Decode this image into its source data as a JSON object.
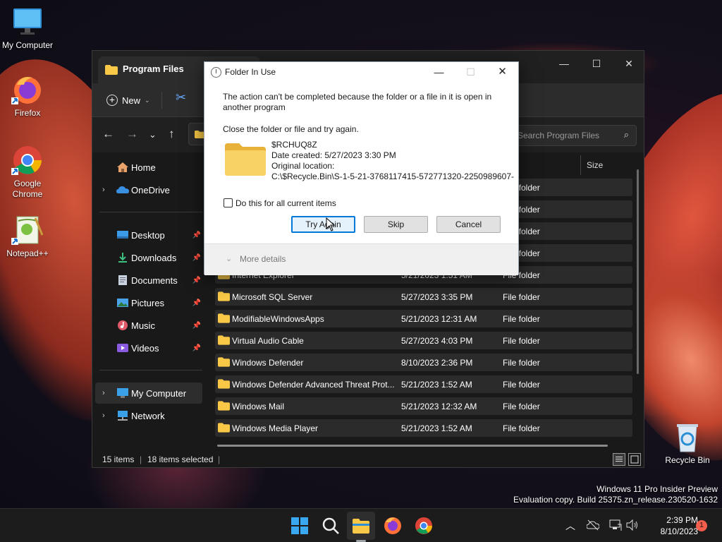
{
  "desktop": {
    "icons": [
      {
        "label": "My Computer",
        "icon": "monitor-icon"
      },
      {
        "label": "Firefox",
        "icon": "firefox-icon"
      },
      {
        "label": "Google Chrome",
        "icon": "chrome-icon"
      },
      {
        "label": "Notepad++",
        "icon": "notepadpp-icon"
      },
      {
        "label": "Recycle Bin",
        "icon": "recycle-bin-icon"
      }
    ],
    "watermark_line1": "Windows 11 Pro Insider Preview",
    "watermark_line2": "Evaluation copy. Build 25375.zn_release.230520-1632"
  },
  "explorer": {
    "tab_title": "Program Files",
    "new_label": "New",
    "search_placeholder": "Search Program Files",
    "size_header": "Size",
    "sidebar": [
      {
        "label": "Home"
      },
      {
        "label": "OneDrive"
      },
      {
        "label": "Desktop"
      },
      {
        "label": "Downloads"
      },
      {
        "label": "Documents"
      },
      {
        "label": "Pictures"
      },
      {
        "label": "Music"
      },
      {
        "label": "Videos"
      },
      {
        "label": "My Computer"
      },
      {
        "label": "Network"
      }
    ],
    "rows": [
      {
        "name": "",
        "date": "",
        "type": "File folder"
      },
      {
        "name": "",
        "date": "",
        "type": "File folder"
      },
      {
        "name": "",
        "date": "",
        "type": "File folder"
      },
      {
        "name": "",
        "date": "",
        "type": "File folder"
      },
      {
        "name": "Internet Explorer",
        "date": "5/21/2023 1:51 AM",
        "type": "File folder"
      },
      {
        "name": "Microsoft SQL Server",
        "date": "5/27/2023 3:35 PM",
        "type": "File folder"
      },
      {
        "name": "ModifiableWindowsApps",
        "date": "5/21/2023 12:31 AM",
        "type": "File folder"
      },
      {
        "name": "Virtual Audio Cable",
        "date": "5/27/2023 4:03 PM",
        "type": "File folder"
      },
      {
        "name": "Windows Defender",
        "date": "8/10/2023 2:36 PM",
        "type": "File folder"
      },
      {
        "name": "Windows Defender Advanced Threat Prot...",
        "date": "5/21/2023 1:52 AM",
        "type": "File folder"
      },
      {
        "name": "Windows Mail",
        "date": "5/21/2023 12:32 AM",
        "type": "File folder"
      },
      {
        "name": "Windows Media Player",
        "date": "5/21/2023 1:52 AM",
        "type": "File folder"
      }
    ],
    "status_items": "15 items",
    "status_selected": "18 items selected"
  },
  "dialog": {
    "title": "Folder In Use",
    "message": "The action can't be completed because the folder or a file in it is open in another program",
    "instruction": "Close the folder or file and try again.",
    "item_name": "$RCHUQ8Z",
    "date_created": "Date created: 5/27/2023 3:30 PM",
    "original_location_label": "Original location:",
    "original_location": "C:\\$Recycle.Bin\\S-1-5-21-3768117415-572771320-2250989607-",
    "checkbox_label": "Do this for all current items",
    "try_again": "Try Again",
    "skip": "Skip",
    "cancel": "Cancel",
    "more_details": "More details"
  },
  "taskbar": {
    "time": "2:39 PM",
    "date": "8/10/2023",
    "notification_count": "1"
  }
}
